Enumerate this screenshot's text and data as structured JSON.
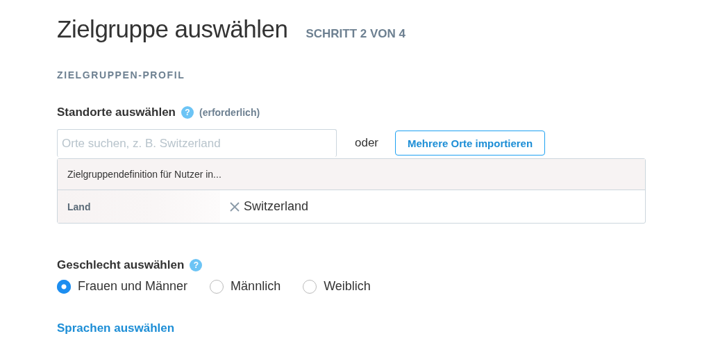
{
  "header": {
    "title": "Zielgruppe auswählen",
    "step": "SCHRITT 2 VON 4"
  },
  "section": "ZIELGRUPPEN-PROFIL",
  "locations": {
    "label": "Standorte auswählen",
    "help": "?",
    "required": "(erforderlich)",
    "search": {
      "placeholder": "Orte suchen, z. B. Switzerland"
    },
    "or": "oder",
    "import_button": "Mehrere Orte importieren",
    "table": {
      "caption": "Zielgruppendefinition für Nutzer in...",
      "rows": [
        {
          "label": "Land",
          "value": "Switzerland"
        }
      ]
    }
  },
  "gender": {
    "label": "Geschlecht auswählen",
    "help": "?",
    "options": [
      {
        "label": "Frauen und Männer",
        "selected": true
      },
      {
        "label": "Männlich",
        "selected": false
      },
      {
        "label": "Weiblich",
        "selected": false
      }
    ]
  },
  "languages_link": "Sprachen auswählen"
}
